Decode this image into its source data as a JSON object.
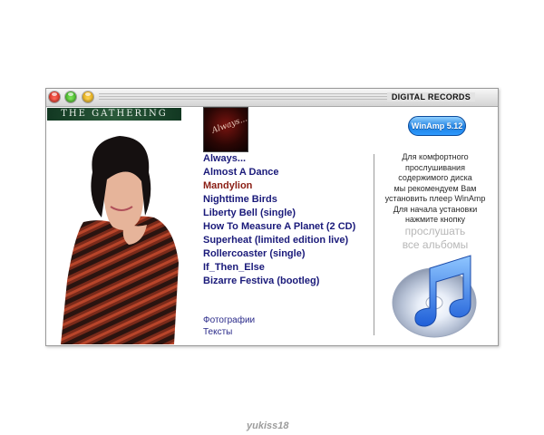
{
  "window": {
    "title": "DIGITAL RECORDS",
    "band_logo": "THE GATHERING",
    "album_cover_text": "Always..."
  },
  "albums": [
    "Always...",
    "Almost A Dance",
    "Mandylion",
    "Nighttime Birds",
    "Liberty Bell (single)",
    "How To Measure A Planet (2 CD)",
    "Superheat (limited edition live)",
    "Rollercoaster (single)",
    "If_Then_Else",
    "Bizarre Festiva (bootleg)"
  ],
  "active_album_index": 2,
  "links": {
    "photos": "Фотографии",
    "texts": "Тексты"
  },
  "winamp": {
    "button_label": "WinAmp 5.12",
    "info_lines": [
      "Для комфортного",
      "прослушивания",
      "содержимого диска",
      "мы рекомендуем Вам",
      "установить плеер WinAmp",
      "Для начала установки",
      "нажмите кнопку"
    ],
    "play_all_lines": [
      "прослушать",
      "все альбомы"
    ]
  },
  "icons": {
    "close": "close-icon",
    "minimize": "minimize-icon",
    "zoom": "zoom-icon",
    "itunes": "itunes-music-icon"
  },
  "colors": {
    "album_link": "#1a1a7a",
    "album_active": "#8a1d13",
    "band_logo_bg": "#1f4a2e",
    "winamp_button": "#1f7fe0"
  },
  "watermark": "yukiss18"
}
